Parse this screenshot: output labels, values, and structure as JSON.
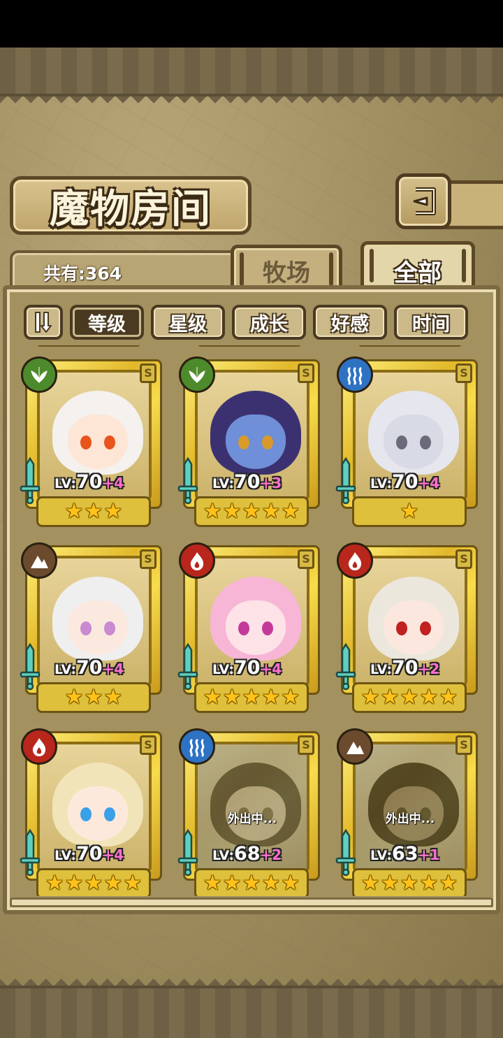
{
  "screen": {
    "title": "魔物房间",
    "owned_count": "共有:364"
  },
  "tabs": [
    {
      "label": "牧场",
      "selected": false
    },
    {
      "label": "全部",
      "selected": true
    }
  ],
  "sort": {
    "toggle_icon": "pause-sort-icon",
    "options": [
      {
        "label": "等级",
        "active": true
      },
      {
        "label": "星级",
        "active": false
      },
      {
        "label": "成长",
        "active": false
      },
      {
        "label": "好感",
        "active": false
      },
      {
        "label": "时间",
        "active": false
      }
    ]
  },
  "colors": {
    "grass": "#4d8a2c",
    "water": "#2e72c4",
    "fire": "#b8261c",
    "earth": "#6b4a2e",
    "card_gold": "#e2b82a",
    "bonus_pink": "#ff6fcf"
  },
  "monsters": [
    {
      "element": "grass",
      "rarity": "S",
      "lv_label": "LV:",
      "level": "70",
      "bonus": "+4",
      "stars": 3,
      "away": "",
      "hair": "#f4f1ee",
      "face": "#fde6d6",
      "eye": "#e8541c"
    },
    {
      "element": "grass",
      "rarity": "S",
      "lv_label": "LV:",
      "level": "70",
      "bonus": "+3",
      "stars": 5,
      "away": "",
      "hair": "#3c3170",
      "face": "#6f8fd8",
      "eye": "#d89a2a"
    },
    {
      "element": "water",
      "rarity": "S",
      "lv_label": "LV:",
      "level": "70",
      "bonus": "+4",
      "stars": 1,
      "away": "",
      "hair": "#e6e6ee",
      "face": "#d8dae6",
      "eye": "#6a6a7a"
    },
    {
      "element": "earth",
      "rarity": "S",
      "lv_label": "LV:",
      "level": "70",
      "bonus": "+4",
      "stars": 3,
      "away": "",
      "hair": "#efefef",
      "face": "#fbe9e0",
      "eye": "#c88ad0"
    },
    {
      "element": "fire",
      "rarity": "S",
      "lv_label": "LV:",
      "level": "70",
      "bonus": "+4",
      "stars": 5,
      "away": "",
      "hair": "#f7b6d6",
      "face": "#fde2e8",
      "eye": "#c33a9a"
    },
    {
      "element": "fire",
      "rarity": "S",
      "lv_label": "LV:",
      "level": "70",
      "bonus": "+2",
      "stars": 5,
      "away": "",
      "hair": "#ebe7dc",
      "face": "#fbe7de",
      "eye": "#c02020"
    },
    {
      "element": "fire",
      "rarity": "S",
      "lv_label": "LV:",
      "level": "70",
      "bonus": "+4",
      "stars": 5,
      "away": "",
      "hair": "#f1e4b8",
      "face": "#fde9dc",
      "eye": "#3aa0e8"
    },
    {
      "element": "water",
      "rarity": "S",
      "lv_label": "LV:",
      "level": "68",
      "bonus": "+2",
      "stars": 5,
      "away": "外出中...",
      "hair": "#5b4a3a",
      "face": "#e7c9a8",
      "eye": "#8a6a3a"
    },
    {
      "element": "earth",
      "rarity": "S",
      "lv_label": "LV:",
      "level": "63",
      "bonus": "+1",
      "stars": 5,
      "away": "外出中...",
      "hair": "#3a2a1e",
      "face": "#b68758",
      "eye": "#5a3a1a"
    }
  ]
}
